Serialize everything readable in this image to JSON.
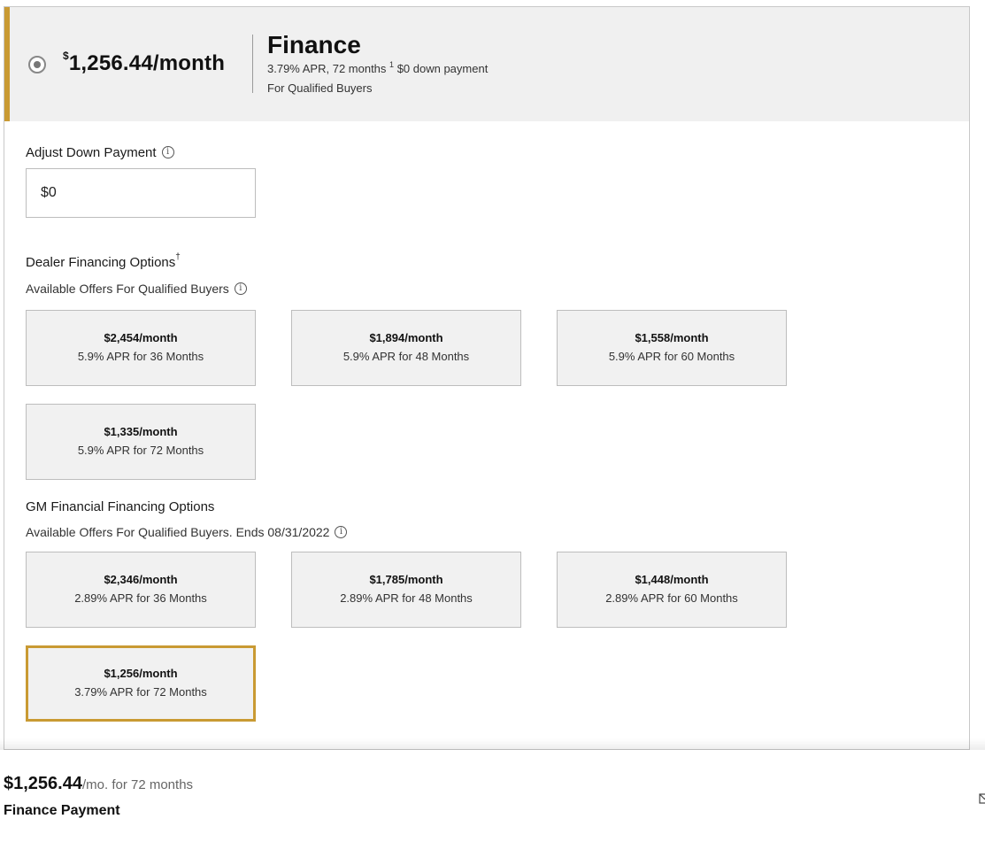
{
  "header": {
    "price_superscript": "$",
    "price_main": "1,256.44/month",
    "title": "Finance",
    "subtitle_part1": "3.79% APR, 72 months",
    "subtitle_footnote": "1",
    "subtitle_part2": "$0 down payment",
    "subtitle_line2": "For Qualified Buyers"
  },
  "down_payment": {
    "label": "Adjust Down Payment",
    "value": "$0",
    "info_icon": "info-icon"
  },
  "dealer_section": {
    "title": "Dealer Financing Options",
    "title_footnote": "†",
    "subtitle": "Available Offers For Qualified Buyers",
    "options": [
      {
        "price": "$2,454/month",
        "terms": "5.9% APR for 36 Months"
      },
      {
        "price": "$1,894/month",
        "terms": "5.9% APR for 48 Months"
      },
      {
        "price": "$1,558/month",
        "terms": "5.9% APR for 60 Months"
      },
      {
        "price": "$1,335/month",
        "terms": "5.9% APR for 72 Months"
      }
    ]
  },
  "gm_section": {
    "title": "GM Financial Financing Options",
    "subtitle": "Available Offers For Qualified Buyers. Ends 08/31/2022",
    "options": [
      {
        "price": "$2,346/month",
        "terms": "2.89% APR for 36 Months"
      },
      {
        "price": "$1,785/month",
        "terms": "2.89% APR for 48 Months"
      },
      {
        "price": "$1,448/month",
        "terms": "2.89% APR for 60 Months"
      },
      {
        "price": "$1,256/month",
        "terms": "3.79% APR for 72 Months",
        "selected": true
      }
    ]
  },
  "footer": {
    "amount": "$1,256.44",
    "per": "/mo. for 72 months",
    "label": "Finance Payment"
  },
  "colors": {
    "accent_gold": "#c99a33",
    "header_bg": "#f0f0f0",
    "option_bg": "#f1f1f1"
  }
}
